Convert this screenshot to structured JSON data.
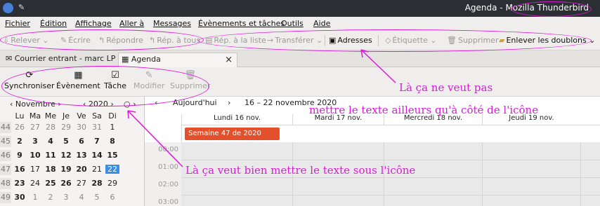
{
  "titlebar": {
    "title_prefix": "Agenda - ",
    "app_name": "Mozilla Thunderbird"
  },
  "menu": [
    "Fichier",
    "Édition",
    "Affichage",
    "Aller à",
    "Messages",
    "Évènements et tâches",
    "Outils",
    "Aide"
  ],
  "mail_toolbar": {
    "get": "Relever",
    "write": "Écrire",
    "reply": "Répondre",
    "reply_all": "Rép. à tous",
    "reply_list": "Rép. à la liste",
    "forward": "Transférer",
    "address": "Adresses",
    "tag": "Étiquette",
    "delete": "Supprimer",
    "dedupe": "Enlever les doublons"
  },
  "tabs": [
    {
      "label": "Courrier entrant - marc LP"
    },
    {
      "label": "Agenda",
      "close": "×"
    }
  ],
  "cal_toolbar": {
    "sync": "Synchroniser",
    "event": "Évènement",
    "task": "Tâche",
    "edit": "Modifier",
    "delete": "Supprimer"
  },
  "minical": {
    "month": "Novembre",
    "year": "2020",
    "days": [
      "Lu",
      "Ma",
      "Me",
      "Je",
      "Ve",
      "Sa",
      "Di"
    ],
    "weeks": [
      {
        "num": "44",
        "days": [
          "26",
          "27",
          "28",
          "29",
          "30",
          "31",
          "1"
        ]
      },
      {
        "num": "45",
        "days": [
          "2",
          "3",
          "4",
          "5",
          "6",
          "7",
          "8"
        ]
      },
      {
        "num": "46",
        "days": [
          "9",
          "10",
          "11",
          "12",
          "13",
          "14",
          "15"
        ]
      },
      {
        "num": "47",
        "days": [
          "16",
          "17",
          "18",
          "19",
          "20",
          "21",
          "22"
        ]
      },
      {
        "num": "48",
        "days": [
          "23",
          "24",
          "25",
          "26",
          "27",
          "28",
          "29"
        ]
      },
      {
        "num": "49",
        "days": [
          "30",
          "1",
          "2",
          "3",
          "4",
          "5",
          "6"
        ]
      }
    ]
  },
  "view": {
    "today": "Aujourd'hui",
    "range": "16 – 22 novembre 2020",
    "days": [
      "Lundi 16 nov.",
      "Mardi 17 nov.",
      "Mercredi 18 nov.",
      "Jeudi 19 nov."
    ],
    "week_event": "Semaine 47 de 2020",
    "hours": [
      "00:00",
      "01:00",
      "02:00",
      "03:00"
    ]
  },
  "annotations": {
    "a1_line1": "Là ça ne veut pas",
    "a1_line2": "mettre le texte ailleurs qu'à côté de l'icône",
    "a2": "Là ça veut bien mettre le texte sous l'icône"
  },
  "colors": {
    "accent": "#e018d8",
    "event": "#e4502c",
    "today": "#3a8ee6"
  }
}
